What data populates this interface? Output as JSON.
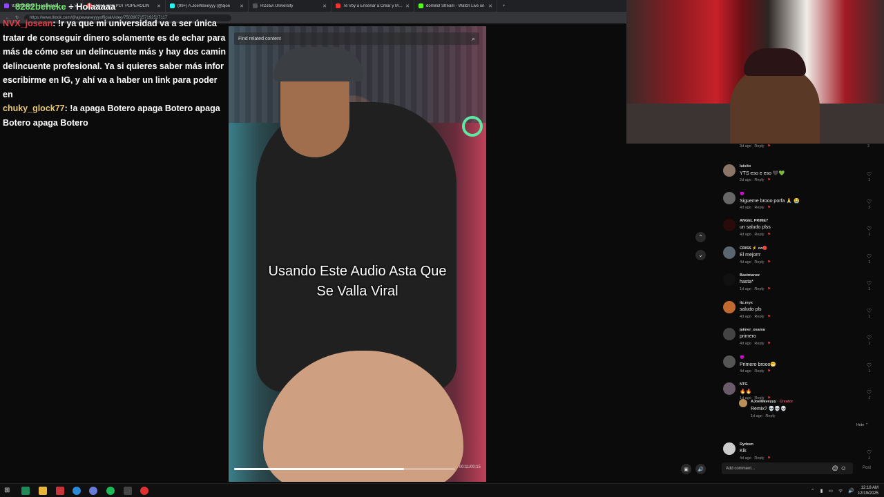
{
  "browser": {
    "tabs": [
      {
        "label": "8282beheke ÷ Holaaaaa",
        "color": "#9146ff"
      },
      {
        "label": "WAVEYYY PUT POPEROLIN",
        "color": "#e33"
      },
      {
        "label": "(99+) A.JoeWaveyyy (@ajoe",
        "color": "#25f4ee"
      },
      {
        "label": "RDJavi University",
        "color": "#555"
      },
      {
        "label": "Te Voy a Enseñar a Crear y Monet",
        "color": "#e33"
      },
      {
        "label": "domiilol Stream - Watch Live on",
        "color": "#53fc18"
      }
    ],
    "url": "https://www.tiktok.com/@ajoewaveyyyofficial/video/7583907157192527117"
  },
  "chat": {
    "top_user": "8282beheke",
    "top_text": "Holaaaaa",
    "messages": [
      {
        "user": "NVX_josean",
        "user_color": "#e0404a",
        "text": ": !r ya que mi universidad va a ser única tratar de conseguir dinero solamente es de echar para más de cómo ser un delincuente más y hay dos camin delincuente profesional. Ya si quieres saber más infor escribirme en IG, y ahí va a haber un link para poder en"
      },
      {
        "user": "chuky_glock77",
        "user_color": "#e8c87a",
        "text": ": !a apaga Botero apaga Botero apaga Botero apaga Botero"
      }
    ]
  },
  "video": {
    "search_placeholder": "Find related content",
    "caption_line1": "Usando Este Audio Asta Que",
    "caption_line2": "Se Valla Viral",
    "progress_fraction": 0.77,
    "time": "00:11/00:15"
  },
  "comments": {
    "first_meta": {
      "date": "3d ago",
      "reply": "Reply"
    },
    "first_count": "3",
    "items": [
      {
        "user": "luisito",
        "text": "YTS eso e eso 🖤💚",
        "date": "2d ago",
        "reply": "Reply",
        "likes": "1",
        "avatar": "#8a7566"
      },
      {
        "user": "😈",
        "text": "Sigueme brooo porfa 🙏 😭",
        "date": "4d ago",
        "reply": "Reply",
        "likes": "2",
        "avatar": "#666"
      },
      {
        "user": "ANGEL PRIME7",
        "text": "un saludo plss",
        "date": "4d ago",
        "reply": "Reply",
        "likes": "1",
        "avatar": "#2a0a0a"
      },
      {
        "user": "CRISS ⚡ oo🔴",
        "text": "El mejorrr",
        "date": "4d ago",
        "reply": "Reply",
        "likes": "1",
        "avatar": "#5b6570"
      },
      {
        "user": "Bastmanez",
        "text": "hasta*",
        "date": "1d ago",
        "reply": "Reply",
        "likes": "1",
        "avatar": "#111"
      },
      {
        "user": "itz.reyx",
        "text": "saludo pls",
        "date": "4d ago",
        "reply": "Reply",
        "likes": "1",
        "avatar": "#c06a30"
      },
      {
        "user": "jaimer_osama",
        "text": "primero",
        "date": "4d ago",
        "reply": "Reply",
        "likes": "1",
        "avatar": "#444"
      },
      {
        "user": "😈",
        "text": "Primero brooo😁",
        "date": "4d ago",
        "reply": "Reply",
        "likes": "1",
        "avatar": "#555"
      },
      {
        "user": "NTG",
        "text": "🔥🔥",
        "date": "1d ago",
        "reply": "Reply",
        "likes": "1",
        "avatar": "#6b5a6a"
      },
      {
        "user": "Rydeen",
        "text": "Klk",
        "date": "4d ago",
        "reply": "Reply",
        "likes": "1",
        "avatar": "#ccc"
      }
    ],
    "reply": {
      "user": "AJoeWaveyyy",
      "creator": "· Creator",
      "text": "Remix? 💀💀💀",
      "date": "1d ago",
      "reply_label": "Reply"
    },
    "hide_label": "Hide ⌃",
    "add_placeholder": "Add comment...",
    "post_label": "Post"
  },
  "taskbar": {
    "time": "12:18 AM",
    "date": "12/19/2025"
  }
}
